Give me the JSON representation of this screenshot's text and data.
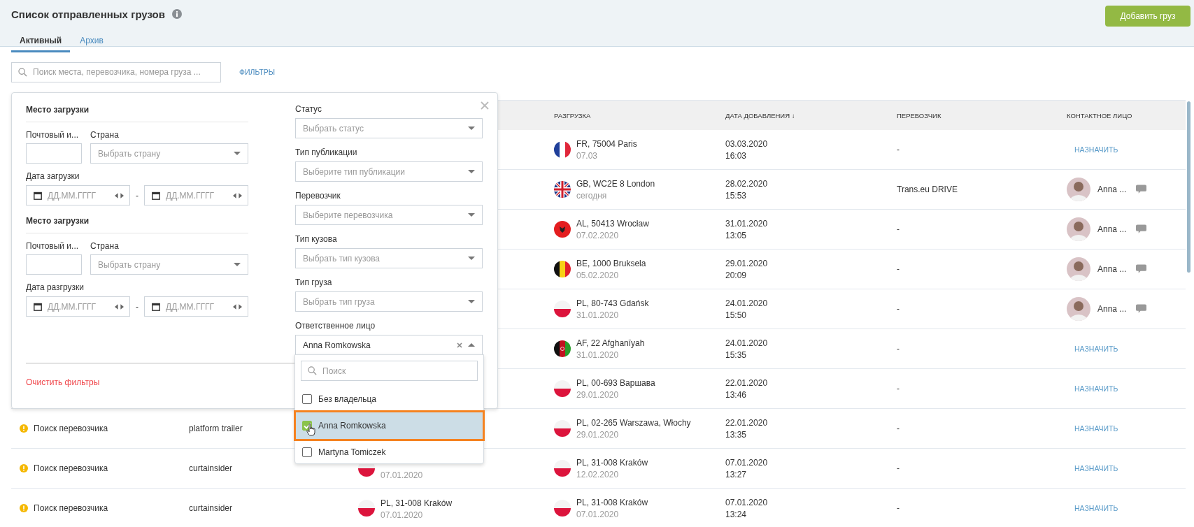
{
  "header": {
    "title": "Список отправленных грузов",
    "add_button": "Добавить груз"
  },
  "tabs": [
    {
      "label": "Активный",
      "selected": true
    },
    {
      "label": "Архив",
      "selected": false
    }
  ],
  "search": {
    "placeholder": "Поиск места, перевозчика, номера груза ..."
  },
  "filters_link": "ФИЛЬТРЫ",
  "table": {
    "columns": [
      "РАЗГРУЗКА",
      "ДАТА ДОБАВЛЕНИЯ ↓",
      "ПЕРЕВОЗЧИК",
      "КОНТАКТНОЕ ЛИЦО"
    ],
    "rows": [
      {
        "unloading": {
          "place": "FR, 75004 Paris",
          "date": "07.03",
          "kind": "fr"
        },
        "added": {
          "date": "03.03.2020",
          "time": "16:03"
        },
        "carrier": "-",
        "contact": {
          "kind": "assign",
          "label": "НАЗНАЧИТЬ"
        }
      },
      {
        "unloading": {
          "place": "GB, WC2E 8 London",
          "date": "сегодня",
          "kind": "gb"
        },
        "added": {
          "date": "28.02.2020",
          "time": "15:53"
        },
        "carrier": "Trans.eu DRIVE",
        "contact": {
          "kind": "person",
          "name": "Anna ..."
        }
      },
      {
        "unloading": {
          "place": "AL, 50413 Wrocław",
          "date": "07.02.2020",
          "kind": "al"
        },
        "added": {
          "date": "31.01.2020",
          "time": "13:05"
        },
        "carrier": "-",
        "contact": {
          "kind": "person",
          "name": "Anna ..."
        }
      },
      {
        "unloading": {
          "place": "BE, 1000 Bruksela",
          "date": "05.02.2020",
          "kind": "be"
        },
        "added": {
          "date": "29.01.2020",
          "time": "20:09"
        },
        "carrier": "-",
        "contact": {
          "kind": "person",
          "name": "Anna ..."
        }
      },
      {
        "unloading": {
          "place": "PL, 80-743 Gdańsk",
          "date": "31.01.2020",
          "kind": "pl"
        },
        "added": {
          "date": "24.01.2020",
          "time": "15:50"
        },
        "carrier": "-",
        "contact": {
          "kind": "person",
          "name": "Anna ..."
        }
      },
      {
        "unloading": {
          "place": "AF, 22 Afghanīyah",
          "date": "31.01.2020",
          "kind": "af"
        },
        "added": {
          "date": "24.01.2020",
          "time": "15:35"
        },
        "carrier": "-",
        "contact": {
          "kind": "assign",
          "label": "НАЗНАЧИТЬ"
        }
      },
      {
        "unloading": {
          "place": "PL, 00-693 Варшава",
          "date": "29.01.2020",
          "kind": "pl"
        },
        "added": {
          "date": "22.01.2020",
          "time": "13:46"
        },
        "carrier": "-",
        "contact": {
          "kind": "assign",
          "label": "НАЗНАЧИТЬ"
        }
      },
      {
        "status": "Поиск перевозчика",
        "type": "platform trailer",
        "unloading": {
          "place": "PL, 02-265 Warszawa, Włochy",
          "date": "29.01.2020",
          "kind": "pl"
        },
        "added": {
          "date": "22.01.2020",
          "time": "13:35"
        },
        "carrier": "-",
        "contact": {
          "kind": "assign",
          "label": "НАЗНАЧИТЬ"
        }
      },
      {
        "status": "Поиск перевозчика",
        "type": "curtainsider",
        "loading": {
          "date": "07.01.2020",
          "kind": "pl"
        },
        "unloading": {
          "place": "PL, 31-008 Kraków",
          "date": "12.02.2020",
          "kind": "pl"
        },
        "added": {
          "date": "07.01.2020",
          "time": "13:27"
        },
        "carrier": "-",
        "contact": {
          "kind": "assign",
          "label": "НАЗНАЧИТЬ"
        }
      },
      {
        "status": "Поиск перевозчика",
        "type": "curtainsider",
        "loading": {
          "place": "PL, 31-008 Kraków",
          "date": "07.01.2020",
          "kind": "pl"
        },
        "unloading": {
          "place": "PL, 31-008 Kraków",
          "date": "07.01.2020",
          "kind": "pl"
        },
        "added": {
          "date": "07.01.2020",
          "time": "13:24"
        },
        "carrier": "-",
        "contact": {
          "kind": "assign",
          "label": "НАЗНАЧИТЬ"
        }
      }
    ]
  },
  "filter_panel": {
    "sections": [
      {
        "title": "Место загрузки",
        "postal_label": "Почтовый и...",
        "country_label": "Страна",
        "country_placeholder": "Выбрать страну",
        "date_label": "Дата загрузки",
        "date_from": "ДД.ММ.ГГГГ",
        "separator": "-",
        "date_to": "ДД.ММ.ГГГГ"
      },
      {
        "title": "Место загрузки",
        "postal_label": "Почтовый и...",
        "country_label": "Страна",
        "country_placeholder": "Выбрать страну",
        "date_label": "Дата разгрузки",
        "date_from": "ДД.ММ.ГГГГ",
        "separator": "-",
        "date_to": "ДД.ММ.ГГГГ"
      }
    ],
    "selects": [
      {
        "label": "Статус",
        "placeholder": "Выбрать статус"
      },
      {
        "label": "Тип публикации",
        "placeholder": "Выберите тип публикации"
      },
      {
        "label": "Перевозчик",
        "placeholder": "Выберите перевозчика"
      },
      {
        "label": "Тип кузова",
        "placeholder": "Выбрать тип кузова"
      },
      {
        "label": "Тип груза",
        "placeholder": "Выбрать тип груза"
      }
    ],
    "responsible": {
      "label": "Ответственное лицо",
      "value": "Anna Romkowska",
      "expanded": true
    },
    "clear_link": "Очистить фильтры"
  },
  "dropdown": {
    "search_placeholder": "Поиск",
    "options": [
      {
        "label": "Без владельца",
        "checked": false,
        "selected": false
      },
      {
        "label": "Anna Romkowska",
        "checked": true,
        "selected": true
      },
      {
        "label": "Martyna Tomiczek",
        "checked": false,
        "selected": false
      }
    ]
  }
}
